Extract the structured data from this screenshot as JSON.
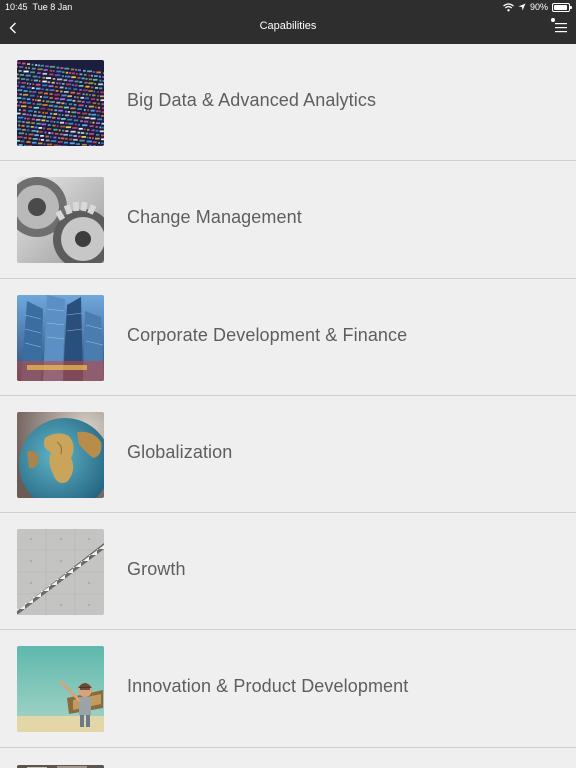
{
  "status_bar": {
    "time": "10:45",
    "date": "Tue 8 Jan",
    "battery": "90%",
    "battery_level": 0.9
  },
  "nav": {
    "title": "Capabilities",
    "back_icon": "chevron-left-icon",
    "menu_icon": "menu-icon"
  },
  "items": [
    {
      "label": "Big Data & Advanced Analytics",
      "thumb": "data-code-image"
    },
    {
      "label": "Change Management",
      "thumb": "gears-image"
    },
    {
      "label": "Corporate Development & Finance",
      "thumb": "skyscrapers-image"
    },
    {
      "label": "Globalization",
      "thumb": "globe-image"
    },
    {
      "label": "Growth",
      "thumb": "stairs-image"
    },
    {
      "label": "Innovation & Product Development",
      "thumb": "child-aviator-image"
    },
    {
      "label": "",
      "thumb": "partial-image"
    }
  ],
  "colors": {
    "topbar": "#2e2e2e",
    "background": "#efefef",
    "divider": "#cfcfcf",
    "label": "#5e5e5e"
  }
}
